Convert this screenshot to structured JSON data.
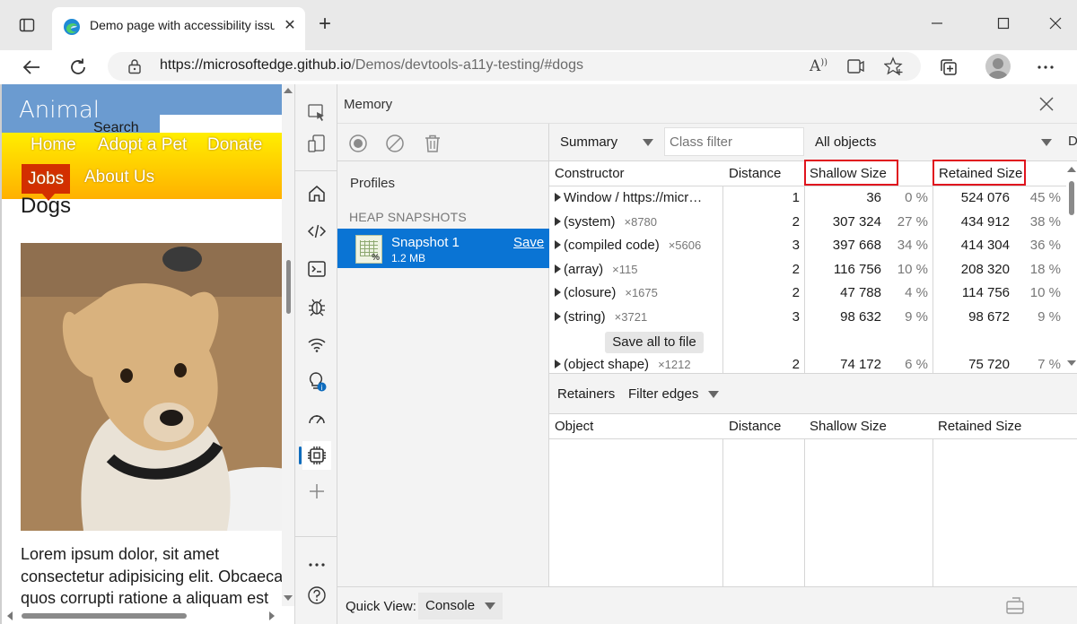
{
  "browser": {
    "tab_title": "Demo page with accessibility issues",
    "url_host": "https://microsoftedge.github.io",
    "url_path": "/Demos/devtools-a11y-testing/#dogs"
  },
  "webpage": {
    "site_title": "Animal",
    "search_label": "Search",
    "nav": [
      "Home",
      "Adopt a Pet",
      "Donate",
      "Jobs",
      "About Us"
    ],
    "heading": "Dogs",
    "lorem": [
      "Lorem ipsum dolor, sit amet",
      "consectetur adipisicing elit. Obcaecati",
      "quos corrupti ratione a aliquam est"
    ]
  },
  "devtools": {
    "panel_title": "Memory",
    "profiles_label": "Profiles",
    "section_label": "HEAP SNAPSHOTS",
    "snapshot": {
      "name": "Snapshot 1",
      "size": "1.2 MB",
      "save": "Save"
    },
    "toolbar": {
      "view": "Summary",
      "class_filter_placeholder": "Class filter",
      "objects": "All objects",
      "more": "D"
    },
    "columns": {
      "constructor": "Constructor",
      "distance": "Distance",
      "shallow": "Shallow Size",
      "retained": "Retained Size"
    },
    "rows": [
      {
        "name": "Window / https://micr…",
        "count": "",
        "distance": "1",
        "shallow": "36",
        "shallow_pct": "0 %",
        "retained": "524 076",
        "retained_pct": "45 %"
      },
      {
        "name": "(system)",
        "count": "×8780",
        "distance": "2",
        "shallow": "307 324",
        "shallow_pct": "27 %",
        "retained": "434 912",
        "retained_pct": "38 %"
      },
      {
        "name": "(compiled code)",
        "count": "×5606",
        "distance": "3",
        "shallow": "397 668",
        "shallow_pct": "34 %",
        "retained": "414 304",
        "retained_pct": "36 %"
      },
      {
        "name": "(array)",
        "count": "×115",
        "distance": "2",
        "shallow": "116 756",
        "shallow_pct": "10 %",
        "retained": "208 320",
        "retained_pct": "18 %"
      },
      {
        "name": "(closure)",
        "count": "×1675",
        "distance": "2",
        "shallow": "47 788",
        "shallow_pct": "4 %",
        "retained": "114 756",
        "retained_pct": "10 %"
      },
      {
        "name": "(string)",
        "count": "×3721",
        "distance": "3",
        "shallow": "98 632",
        "shallow_pct": "9 %",
        "retained": "98 672",
        "retained_pct": "9 %"
      },
      {
        "name": "(object shape)",
        "count": "×1212",
        "distance": "2",
        "shallow": "74 172",
        "shallow_pct": "6 %",
        "retained": "75 720",
        "retained_pct": "7 %"
      }
    ],
    "save_all": "Save all to file",
    "retainers": {
      "label": "Retainers",
      "filter": "Filter edges"
    },
    "retainer_columns": {
      "object": "Object",
      "distance": "Distance",
      "shallow": "Shallow Size",
      "retained": "Retained Size"
    }
  },
  "drawer": {
    "label": "Quick View:",
    "value": "Console"
  },
  "colors": {
    "accent": "#0a74d4",
    "highlight": "#e0141e",
    "nav_active": "#d32f00"
  }
}
